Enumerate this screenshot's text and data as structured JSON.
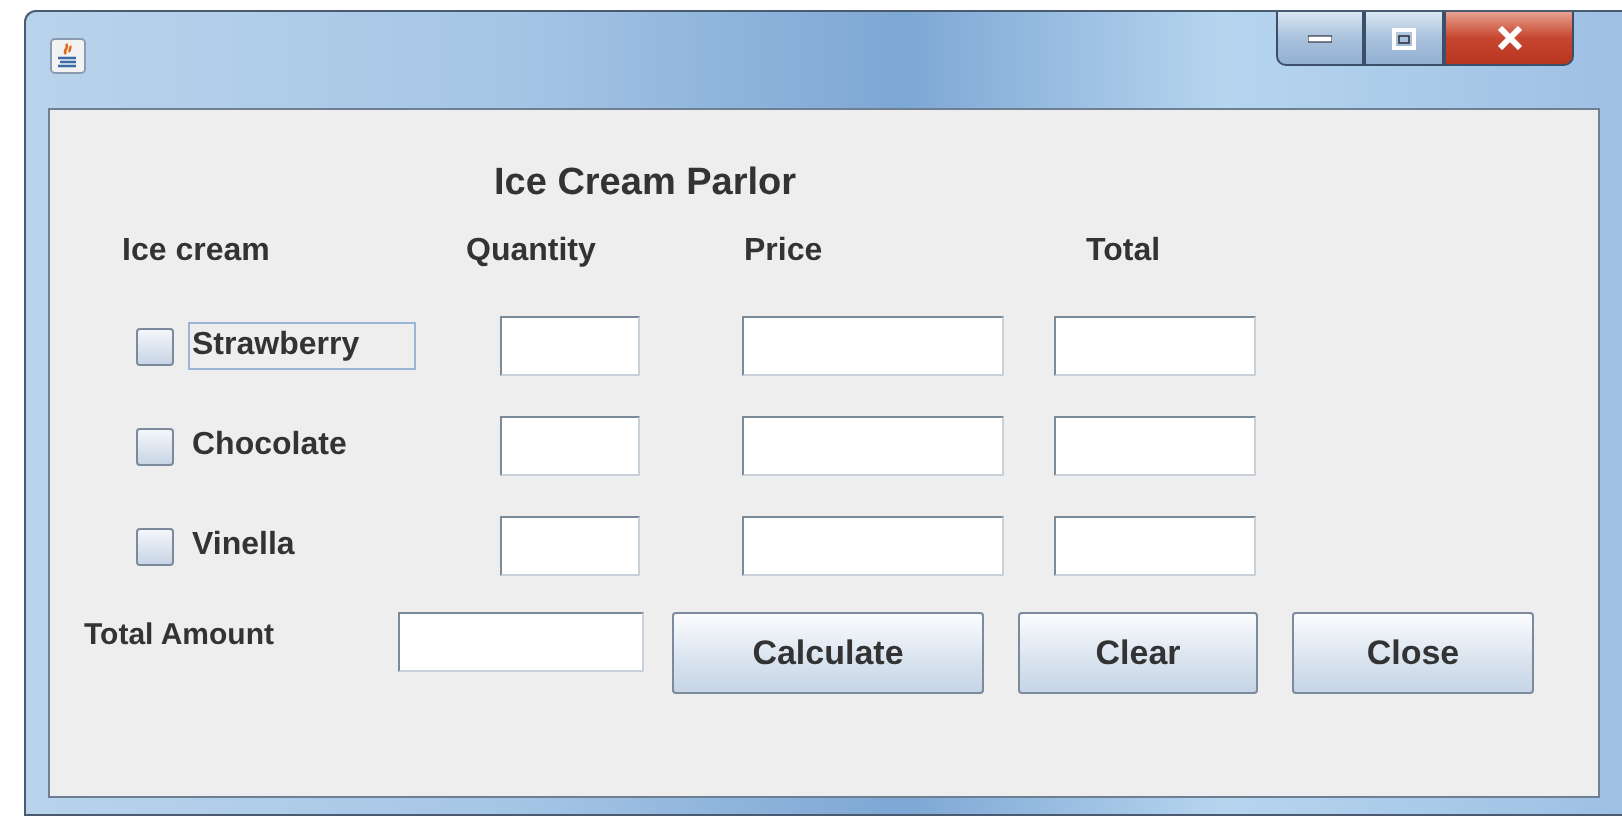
{
  "heading": "Ice Cream Parlor",
  "columns": [
    "Ice cream",
    "Quantity",
    "Price",
    "Total"
  ],
  "rows": [
    {
      "name": "Strawberry",
      "checked": false,
      "focused": true
    },
    {
      "name": "Chocolate",
      "checked": false,
      "focused": false
    },
    {
      "name": "Vinella",
      "checked": false,
      "focused": false
    }
  ],
  "total_amount": {
    "label": "Total Amount"
  },
  "buttons": [
    "Calculate",
    "Clear",
    "Close"
  ]
}
